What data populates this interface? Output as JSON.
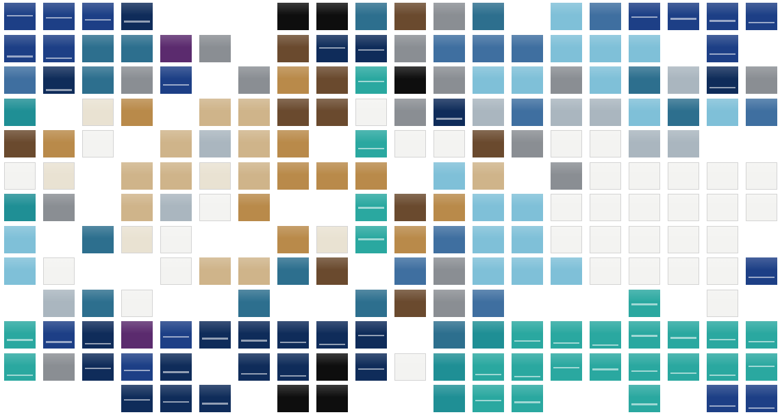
{
  "colors": {
    "bg": "#ffffff",
    "p": [
      "#1d3f86",
      "#e9e2d2",
      "#cfb48a",
      "#aab6bf",
      "#0e0e0e",
      "#3f6fa0",
      "#2aa8a0",
      "#1f8f95",
      "#0f2c5a",
      "#8a8e93",
      "#6a4a2e",
      "#b98a4a",
      "#7fc0d8",
      "#f3f3f1",
      "#5b2b6e",
      "#2d6f8e"
    ]
  },
  "tiles": [
    {
      "c": 0,
      "r": 0,
      "t": 0
    },
    {
      "c": 1,
      "r": 0,
      "t": 0
    },
    {
      "c": 2,
      "r": 0,
      "t": 0
    },
    {
      "c": 3,
      "r": 0,
      "t": 8
    },
    {
      "c": 7,
      "r": 0,
      "t": 4
    },
    {
      "c": 8,
      "r": 0,
      "t": 4
    },
    {
      "c": 9,
      "r": 0,
      "t": 15
    },
    {
      "c": 10,
      "r": 0,
      "t": 10
    },
    {
      "c": 11,
      "r": 0,
      "t": 9
    },
    {
      "c": 12,
      "r": 0,
      "t": 15
    },
    {
      "c": 14,
      "r": 0,
      "t": 12
    },
    {
      "c": 15,
      "r": 0,
      "t": 5
    },
    {
      "c": 16,
      "r": 0,
      "t": 0
    },
    {
      "c": 17,
      "r": 0,
      "t": 0
    },
    {
      "c": 18,
      "r": 0,
      "t": 0
    },
    {
      "c": 19,
      "r": 0,
      "t": 0
    },
    {
      "c": 0,
      "r": 1,
      "t": 0
    },
    {
      "c": 1,
      "r": 1,
      "t": 0
    },
    {
      "c": 2,
      "r": 1,
      "t": 15
    },
    {
      "c": 3,
      "r": 1,
      "t": 15
    },
    {
      "c": 4,
      "r": 1,
      "t": 14
    },
    {
      "c": 5,
      "r": 1,
      "t": 9
    },
    {
      "c": 7,
      "r": 1,
      "t": 10
    },
    {
      "c": 8,
      "r": 1,
      "t": 8
    },
    {
      "c": 9,
      "r": 1,
      "t": 8
    },
    {
      "c": 10,
      "r": 1,
      "t": 9
    },
    {
      "c": 11,
      "r": 1,
      "t": 5
    },
    {
      "c": 12,
      "r": 1,
      "t": 5
    },
    {
      "c": 13,
      "r": 1,
      "t": 5
    },
    {
      "c": 14,
      "r": 1,
      "t": 12
    },
    {
      "c": 15,
      "r": 1,
      "t": 12
    },
    {
      "c": 16,
      "r": 1,
      "t": 12
    },
    {
      "c": 18,
      "r": 1,
      "t": 0
    },
    {
      "c": 0,
      "r": 2,
      "t": 5
    },
    {
      "c": 1,
      "r": 2,
      "t": 8
    },
    {
      "c": 2,
      "r": 2,
      "t": 15
    },
    {
      "c": 3,
      "r": 2,
      "t": 9
    },
    {
      "c": 4,
      "r": 2,
      "t": 0
    },
    {
      "c": 6,
      "r": 2,
      "t": 9
    },
    {
      "c": 7,
      "r": 2,
      "t": 11
    },
    {
      "c": 8,
      "r": 2,
      "t": 10
    },
    {
      "c": 9,
      "r": 2,
      "t": 6
    },
    {
      "c": 10,
      "r": 2,
      "t": 4
    },
    {
      "c": 11,
      "r": 2,
      "t": 9
    },
    {
      "c": 12,
      "r": 2,
      "t": 12
    },
    {
      "c": 13,
      "r": 2,
      "t": 12
    },
    {
      "c": 14,
      "r": 2,
      "t": 9
    },
    {
      "c": 15,
      "r": 2,
      "t": 12
    },
    {
      "c": 16,
      "r": 2,
      "t": 15
    },
    {
      "c": 17,
      "r": 2,
      "t": 3
    },
    {
      "c": 18,
      "r": 2,
      "t": 8
    },
    {
      "c": 19,
      "r": 2,
      "t": 9
    },
    {
      "c": 0,
      "r": 3,
      "t": 7
    },
    {
      "c": 2,
      "r": 3,
      "t": 1
    },
    {
      "c": 3,
      "r": 3,
      "t": 11
    },
    {
      "c": 5,
      "r": 3,
      "t": 2
    },
    {
      "c": 6,
      "r": 3,
      "t": 2
    },
    {
      "c": 7,
      "r": 3,
      "t": 10
    },
    {
      "c": 8,
      "r": 3,
      "t": 10
    },
    {
      "c": 9,
      "r": 3,
      "t": 13
    },
    {
      "c": 10,
      "r": 3,
      "t": 9
    },
    {
      "c": 11,
      "r": 3,
      "t": 8
    },
    {
      "c": 12,
      "r": 3,
      "t": 3
    },
    {
      "c": 13,
      "r": 3,
      "t": 5
    },
    {
      "c": 14,
      "r": 3,
      "t": 3
    },
    {
      "c": 15,
      "r": 3,
      "t": 3
    },
    {
      "c": 16,
      "r": 3,
      "t": 12
    },
    {
      "c": 17,
      "r": 3,
      "t": 15
    },
    {
      "c": 18,
      "r": 3,
      "t": 12
    },
    {
      "c": 19,
      "r": 3,
      "t": 5
    },
    {
      "c": 0,
      "r": 4,
      "t": 10
    },
    {
      "c": 1,
      "r": 4,
      "t": 11
    },
    {
      "c": 2,
      "r": 4,
      "t": 13
    },
    {
      "c": 4,
      "r": 4,
      "t": 2
    },
    {
      "c": 5,
      "r": 4,
      "t": 3
    },
    {
      "c": 6,
      "r": 4,
      "t": 2
    },
    {
      "c": 7,
      "r": 4,
      "t": 11
    },
    {
      "c": 9,
      "r": 4,
      "t": 6
    },
    {
      "c": 10,
      "r": 4,
      "t": 13
    },
    {
      "c": 11,
      "r": 4,
      "t": 13
    },
    {
      "c": 12,
      "r": 4,
      "t": 10
    },
    {
      "c": 13,
      "r": 4,
      "t": 9
    },
    {
      "c": 14,
      "r": 4,
      "t": 13
    },
    {
      "c": 15,
      "r": 4,
      "t": 13
    },
    {
      "c": 16,
      "r": 4,
      "t": 3
    },
    {
      "c": 17,
      "r": 4,
      "t": 3
    },
    {
      "c": 0,
      "r": 5,
      "t": 13
    },
    {
      "c": 1,
      "r": 5,
      "t": 1
    },
    {
      "c": 3,
      "r": 5,
      "t": 2
    },
    {
      "c": 4,
      "r": 5,
      "t": 2
    },
    {
      "c": 5,
      "r": 5,
      "t": 1
    },
    {
      "c": 6,
      "r": 5,
      "t": 2
    },
    {
      "c": 7,
      "r": 5,
      "t": 11
    },
    {
      "c": 8,
      "r": 5,
      "t": 11
    },
    {
      "c": 9,
      "r": 5,
      "t": 11
    },
    {
      "c": 11,
      "r": 5,
      "t": 12
    },
    {
      "c": 12,
      "r": 5,
      "t": 2
    },
    {
      "c": 14,
      "r": 5,
      "t": 9
    },
    {
      "c": 15,
      "r": 5,
      "t": 13
    },
    {
      "c": 16,
      "r": 5,
      "t": 13
    },
    {
      "c": 17,
      "r": 5,
      "t": 13
    },
    {
      "c": 18,
      "r": 5,
      "t": 13
    },
    {
      "c": 19,
      "r": 5,
      "t": 13
    },
    {
      "c": 0,
      "r": 6,
      "t": 7
    },
    {
      "c": 1,
      "r": 6,
      "t": 9
    },
    {
      "c": 3,
      "r": 6,
      "t": 2
    },
    {
      "c": 4,
      "r": 6,
      "t": 3
    },
    {
      "c": 5,
      "r": 6,
      "t": 13
    },
    {
      "c": 6,
      "r": 6,
      "t": 11
    },
    {
      "c": 9,
      "r": 6,
      "t": 6
    },
    {
      "c": 10,
      "r": 6,
      "t": 10
    },
    {
      "c": 11,
      "r": 6,
      "t": 11
    },
    {
      "c": 12,
      "r": 6,
      "t": 12
    },
    {
      "c": 13,
      "r": 6,
      "t": 12
    },
    {
      "c": 14,
      "r": 6,
      "t": 13
    },
    {
      "c": 15,
      "r": 6,
      "t": 13
    },
    {
      "c": 16,
      "r": 6,
      "t": 13
    },
    {
      "c": 17,
      "r": 6,
      "t": 13
    },
    {
      "c": 18,
      "r": 6,
      "t": 13
    },
    {
      "c": 19,
      "r": 6,
      "t": 13
    },
    {
      "c": 0,
      "r": 7,
      "t": 12
    },
    {
      "c": 2,
      "r": 7,
      "t": 15
    },
    {
      "c": 3,
      "r": 7,
      "t": 1
    },
    {
      "c": 4,
      "r": 7,
      "t": 13
    },
    {
      "c": 7,
      "r": 7,
      "t": 11
    },
    {
      "c": 8,
      "r": 7,
      "t": 1
    },
    {
      "c": 9,
      "r": 7,
      "t": 6
    },
    {
      "c": 10,
      "r": 7,
      "t": 11
    },
    {
      "c": 11,
      "r": 7,
      "t": 5
    },
    {
      "c": 12,
      "r": 7,
      "t": 12
    },
    {
      "c": 13,
      "r": 7,
      "t": 12
    },
    {
      "c": 14,
      "r": 7,
      "t": 13
    },
    {
      "c": 15,
      "r": 7,
      "t": 13
    },
    {
      "c": 16,
      "r": 7,
      "t": 13
    },
    {
      "c": 17,
      "r": 7,
      "t": 13
    },
    {
      "c": 18,
      "r": 7,
      "t": 13
    },
    {
      "c": 0,
      "r": 8,
      "t": 12
    },
    {
      "c": 1,
      "r": 8,
      "t": 13
    },
    {
      "c": 4,
      "r": 8,
      "t": 13
    },
    {
      "c": 5,
      "r": 8,
      "t": 2
    },
    {
      "c": 6,
      "r": 8,
      "t": 2
    },
    {
      "c": 7,
      "r": 8,
      "t": 15
    },
    {
      "c": 8,
      "r": 8,
      "t": 10
    },
    {
      "c": 10,
      "r": 8,
      "t": 5
    },
    {
      "c": 11,
      "r": 8,
      "t": 9
    },
    {
      "c": 12,
      "r": 8,
      "t": 12
    },
    {
      "c": 13,
      "r": 8,
      "t": 12
    },
    {
      "c": 14,
      "r": 8,
      "t": 12
    },
    {
      "c": 15,
      "r": 8,
      "t": 13
    },
    {
      "c": 16,
      "r": 8,
      "t": 13
    },
    {
      "c": 17,
      "r": 8,
      "t": 13
    },
    {
      "c": 18,
      "r": 8,
      "t": 13
    },
    {
      "c": 19,
      "r": 8,
      "t": 0
    },
    {
      "c": 1,
      "r": 9,
      "t": 3
    },
    {
      "c": 2,
      "r": 9,
      "t": 15
    },
    {
      "c": 3,
      "r": 9,
      "t": 13
    },
    {
      "c": 6,
      "r": 9,
      "t": 15
    },
    {
      "c": 9,
      "r": 9,
      "t": 15
    },
    {
      "c": 10,
      "r": 9,
      "t": 10
    },
    {
      "c": 11,
      "r": 9,
      "t": 9
    },
    {
      "c": 12,
      "r": 9,
      "t": 5
    },
    {
      "c": 16,
      "r": 9,
      "t": 6
    },
    {
      "c": 18,
      "r": 9,
      "t": 13
    },
    {
      "c": 0,
      "r": 10,
      "t": 6
    },
    {
      "c": 1,
      "r": 10,
      "t": 0
    },
    {
      "c": 2,
      "r": 10,
      "t": 8
    },
    {
      "c": 3,
      "r": 10,
      "t": 14
    },
    {
      "c": 4,
      "r": 10,
      "t": 0
    },
    {
      "c": 5,
      "r": 10,
      "t": 8
    },
    {
      "c": 6,
      "r": 10,
      "t": 8
    },
    {
      "c": 7,
      "r": 10,
      "t": 8
    },
    {
      "c": 8,
      "r": 10,
      "t": 8
    },
    {
      "c": 9,
      "r": 10,
      "t": 8
    },
    {
      "c": 11,
      "r": 10,
      "t": 15
    },
    {
      "c": 12,
      "r": 10,
      "t": 7
    },
    {
      "c": 13,
      "r": 10,
      "t": 6
    },
    {
      "c": 14,
      "r": 10,
      "t": 6
    },
    {
      "c": 15,
      "r": 10,
      "t": 6
    },
    {
      "c": 16,
      "r": 10,
      "t": 6
    },
    {
      "c": 17,
      "r": 10,
      "t": 6
    },
    {
      "c": 18,
      "r": 10,
      "t": 6
    },
    {
      "c": 19,
      "r": 10,
      "t": 6
    },
    {
      "c": 0,
      "r": 11,
      "t": 6
    },
    {
      "c": 1,
      "r": 11,
      "t": 9
    },
    {
      "c": 2,
      "r": 11,
      "t": 8
    },
    {
      "c": 3,
      "r": 11,
      "t": 0
    },
    {
      "c": 4,
      "r": 11,
      "t": 8
    },
    {
      "c": 6,
      "r": 11,
      "t": 8
    },
    {
      "c": 7,
      "r": 11,
      "t": 8
    },
    {
      "c": 8,
      "r": 11,
      "t": 4
    },
    {
      "c": 9,
      "r": 11,
      "t": 8
    },
    {
      "c": 10,
      "r": 11,
      "t": 13
    },
    {
      "c": 11,
      "r": 11,
      "t": 7
    },
    {
      "c": 12,
      "r": 11,
      "t": 6
    },
    {
      "c": 13,
      "r": 11,
      "t": 6
    },
    {
      "c": 14,
      "r": 11,
      "t": 6
    },
    {
      "c": 15,
      "r": 11,
      "t": 6
    },
    {
      "c": 16,
      "r": 11,
      "t": 6
    },
    {
      "c": 17,
      "r": 11,
      "t": 6
    },
    {
      "c": 18,
      "r": 11,
      "t": 6
    },
    {
      "c": 19,
      "r": 11,
      "t": 6
    },
    {
      "c": 3,
      "r": 12,
      "t": 8
    },
    {
      "c": 4,
      "r": 12,
      "t": 8
    },
    {
      "c": 5,
      "r": 12,
      "t": 8
    },
    {
      "c": 7,
      "r": 12,
      "t": 4
    },
    {
      "c": 8,
      "r": 12,
      "t": 4
    },
    {
      "c": 11,
      "r": 12,
      "t": 7
    },
    {
      "c": 12,
      "r": 12,
      "t": 6
    },
    {
      "c": 13,
      "r": 12,
      "t": 6
    },
    {
      "c": 16,
      "r": 12,
      "t": 6
    },
    {
      "c": 18,
      "r": 12,
      "t": 0
    },
    {
      "c": 19,
      "r": 12,
      "t": 0
    }
  ]
}
